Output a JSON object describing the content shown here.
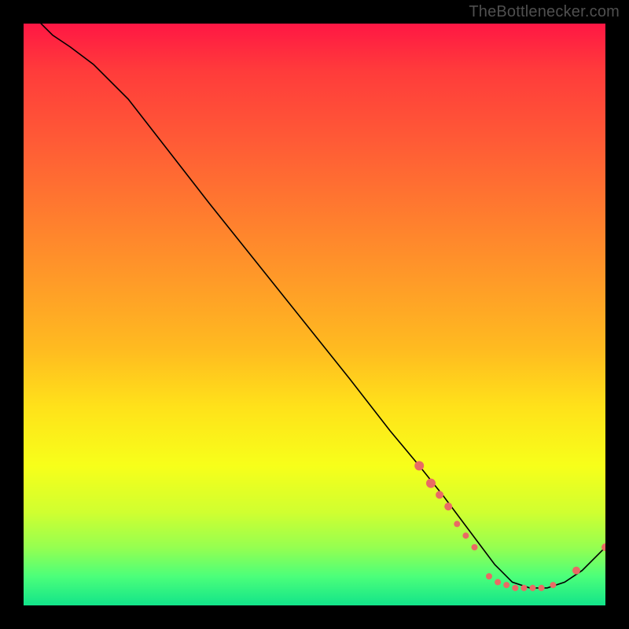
{
  "source_label": "TheBottlenecker.com",
  "colors": {
    "page_bg": "#000000",
    "gradient_top": "#ff1744",
    "gradient_bottom": "#12e48a",
    "curve_stroke": "#000000",
    "marker_fill": "#e96a64",
    "label": "#4f4f4f"
  },
  "chart_data": {
    "type": "line",
    "title": "",
    "xlabel": "",
    "ylabel": "",
    "xlim": [
      0,
      100
    ],
    "ylim": [
      0,
      100
    ],
    "note": "Axes are unlabeled in the source image; values are normalized 0–100 estimates read from pixel positions. The curve descends from near (3,100) to a floor around x≈83–90, y≈3, then rises slightly toward x=100.",
    "series": [
      {
        "name": "curve",
        "x": [
          3,
          5,
          8,
          12,
          18,
          25,
          32,
          40,
          48,
          56,
          63,
          68,
          72,
          75,
          78,
          81,
          84,
          87,
          90,
          93,
          96,
          100
        ],
        "y": [
          100,
          98,
          96,
          93,
          87,
          78,
          69,
          59,
          49,
          39,
          30,
          24,
          19,
          15,
          11,
          7,
          4,
          3,
          3,
          4,
          6,
          10
        ]
      }
    ],
    "markers": [
      {
        "x": 68,
        "y": 24,
        "r": 6
      },
      {
        "x": 70,
        "y": 21,
        "r": 6
      },
      {
        "x": 71.5,
        "y": 19,
        "r": 5
      },
      {
        "x": 73,
        "y": 17,
        "r": 5
      },
      {
        "x": 74.5,
        "y": 14,
        "r": 4
      },
      {
        "x": 76,
        "y": 12,
        "r": 4
      },
      {
        "x": 77.5,
        "y": 10,
        "r": 4
      },
      {
        "x": 80,
        "y": 5,
        "r": 4
      },
      {
        "x": 81.5,
        "y": 4,
        "r": 4
      },
      {
        "x": 83,
        "y": 3.5,
        "r": 4
      },
      {
        "x": 84.5,
        "y": 3,
        "r": 4
      },
      {
        "x": 86,
        "y": 3,
        "r": 4
      },
      {
        "x": 87.5,
        "y": 3,
        "r": 4
      },
      {
        "x": 89,
        "y": 3,
        "r": 4
      },
      {
        "x": 91,
        "y": 3.5,
        "r": 4
      },
      {
        "x": 95,
        "y": 6,
        "r": 5
      },
      {
        "x": 100,
        "y": 10,
        "r": 5
      }
    ]
  }
}
